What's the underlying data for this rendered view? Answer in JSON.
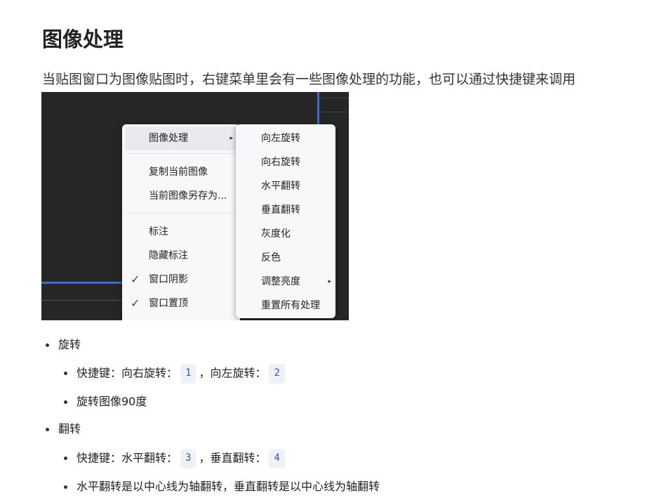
{
  "heading": "图像处理",
  "intro": "当贴图窗口为图像贴图时，右键菜单里会有一些图像处理的功能，也可以通过快捷键来调用",
  "context_menu": {
    "items": [
      {
        "label": "图像处理",
        "has_submenu": true,
        "highlighted": true
      },
      {
        "label": "复制当前图像"
      },
      {
        "label": "当前图像另存为..."
      },
      {
        "label": "标注"
      },
      {
        "label": "隐藏标注"
      },
      {
        "label": "窗口阴影",
        "checked": true
      },
      {
        "label": "窗口置顶",
        "checked": true
      }
    ],
    "check_glyph": "✓",
    "submenu_arrow": "▸"
  },
  "submenu": {
    "items": [
      {
        "label": "向左旋转"
      },
      {
        "label": "向右旋转"
      },
      {
        "label": "水平翻转"
      },
      {
        "label": "垂直翻转"
      },
      {
        "label": "灰度化"
      },
      {
        "label": "反色"
      },
      {
        "label": "调整亮度",
        "has_submenu": true
      },
      {
        "label": "重置所有处理"
      }
    ]
  },
  "sections": [
    {
      "title": "旋转",
      "shortcut_prefix": "快捷键：向右旋转：",
      "key1": "1",
      "mid": "，向左旋转：",
      "key2": "2",
      "desc": "旋转图像90度"
    },
    {
      "title": "翻转",
      "shortcut_prefix": "快捷键：水平翻转：",
      "key1": "3",
      "mid": "，垂直翻转：",
      "key2": "4",
      "desc": "水平翻转是以中心线为轴翻转，垂直翻转是以中心线为轴翻转"
    }
  ],
  "colors": {
    "accent_line": "#3a6bd1",
    "kbd_bg": "#eef1f6",
    "kbd_text": "#3a56a8"
  }
}
